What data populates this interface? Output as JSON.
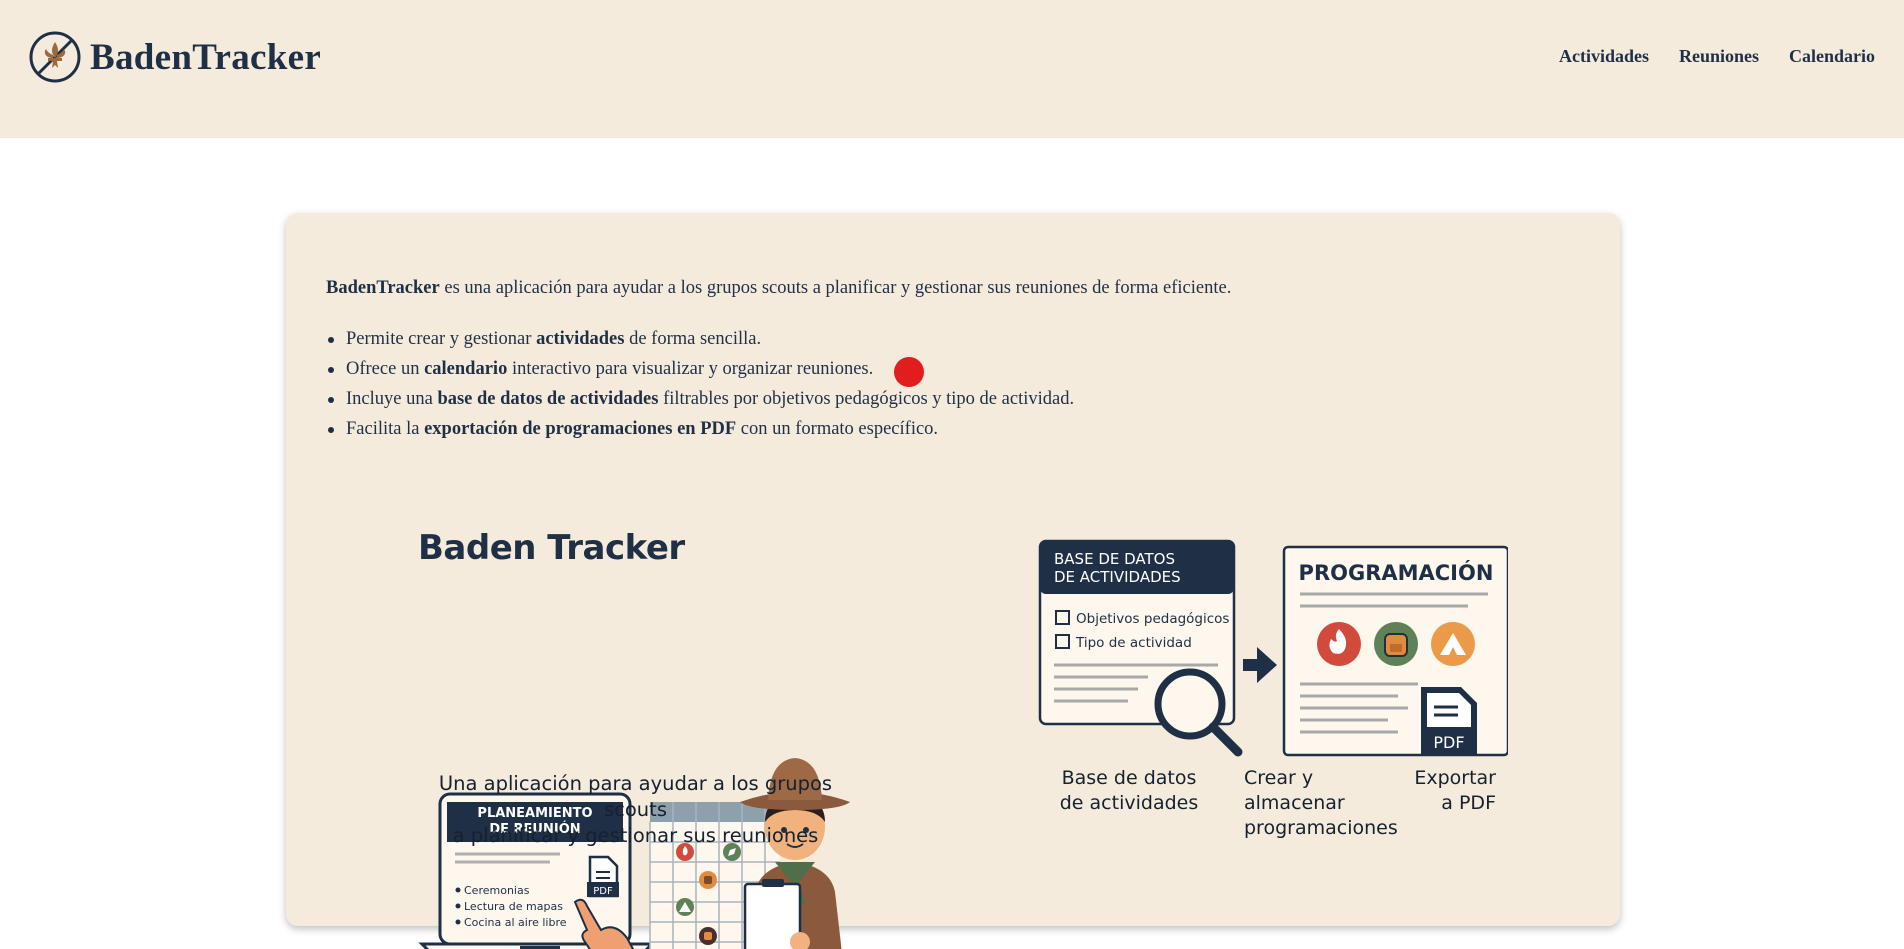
{
  "app": {
    "name": "BadenTracker"
  },
  "nav": {
    "items": [
      "Actividades",
      "Reuniones",
      "Calendario"
    ]
  },
  "intro": {
    "brand": "BadenTracker",
    "text": " es una aplicación para ayudar a los grupos scouts a planificar y gestionar sus reuniones de forma eficiente."
  },
  "features": [
    {
      "pre": "Permite crear y gestionar ",
      "bold": "actividades",
      "post": " de forma sencilla."
    },
    {
      "pre": "Ofrece un ",
      "bold": "calendario",
      "post": " interactivo para visualizar y organizar reuniones."
    },
    {
      "pre": "Incluye una ",
      "bold": "base de datos de actividades",
      "post": " filtrables por objetivos pedagógicos y tipo de actividad."
    },
    {
      "pre": "Facilita la ",
      "bold": "exportación de programaciones en PDF",
      "post": " con un formato específico."
    }
  ],
  "illustration": {
    "title": "Baden Tracker",
    "laptop_header": [
      "PLANEAMIENTO",
      "DE REUNIÓN"
    ],
    "laptop_items": [
      "Ceremonias",
      "Lectura de mapas",
      "Cocina al aire libre"
    ],
    "pdf_label": "PDF",
    "caption": [
      "Una aplicación para ayudar a los grupos scouts",
      "a planificar y gestionar sus reuniones"
    ],
    "db_header": [
      "BASE DE DATOS",
      "DE ACTIVIDADES"
    ],
    "db_filters": [
      "Objetivos pedagógicos",
      "Tipo de actividad"
    ],
    "prog_title": "PROGRAMACIÓN",
    "label_db": [
      "Base de datos",
      "de actividades"
    ],
    "label_create": [
      "Crear y",
      "almacenar",
      "programaciones"
    ],
    "label_export": [
      "Exportar",
      "a PDF"
    ]
  },
  "icons": {
    "logo": "fleur-de-lis-compass-icon",
    "fire": "fire-icon",
    "backpack": "backpack-icon",
    "tent": "tent-icon",
    "compass": "compass-icon",
    "magnifier": "magnifier-icon",
    "arrow": "arrow-right-icon",
    "pdf": "pdf-document-icon"
  },
  "colors": {
    "header_bg": "#f5ebdd",
    "text": "#1f2f45",
    "cursor": "#e21d1d",
    "fire": "#d24a3c",
    "green": "#5f8157",
    "orange": "#eb9a4a"
  }
}
